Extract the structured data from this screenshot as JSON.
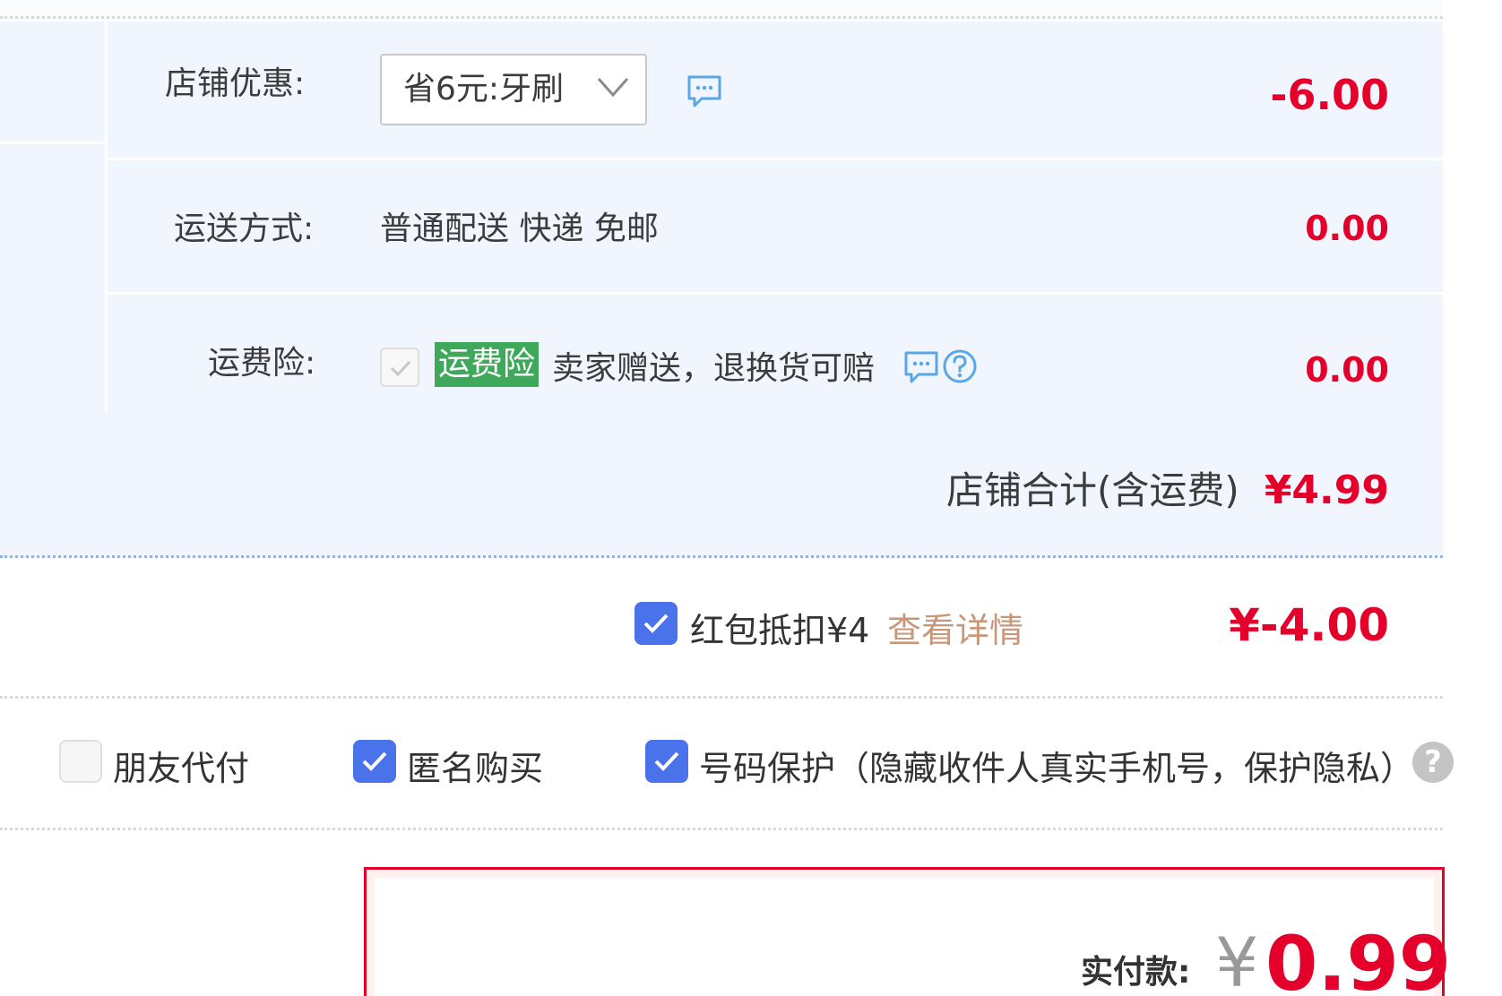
{
  "order": {
    "discount": {
      "label": "店铺优惠:",
      "selected": "省6元:牙刷",
      "amount": "-6.00"
    },
    "shipping": {
      "label": "运送方式:",
      "method": "普通配送 快递 免邮",
      "amount": "0.00"
    },
    "insurance": {
      "label": "运费险:",
      "badge": "运费险",
      "description": "卖家赠送，退换货可赔",
      "amount": "0.00",
      "checked": true
    },
    "store_total": {
      "label": "店铺合计(含运费)",
      "amount": "¥4.99"
    }
  },
  "red_envelope": {
    "checked": true,
    "label": "红包抵扣¥4",
    "link": "查看详情",
    "amount": "¥-4.00"
  },
  "options": [
    {
      "label": "朋友代付",
      "checked": false
    },
    {
      "label": "匿名购买",
      "checked": true
    },
    {
      "label": "号码保护（隐藏收件人真实手机号，保护隐私）",
      "checked": true
    }
  ],
  "payment": {
    "label": "实付款:",
    "currency": "¥",
    "amount": "0.99"
  },
  "colors": {
    "price_red": "#e4002b",
    "block_bg": "#f0f5fe",
    "checkbox_blue": "#4a72ea",
    "badge_green": "#3ea85b",
    "link_tan": "#c8977a",
    "icon_blue": "#5aa7e6"
  },
  "icons": {
    "dropdown": "chevron-down-icon",
    "message": "chat-bubble-icon",
    "help": "question-circle-icon",
    "check": "checkmark-icon"
  }
}
